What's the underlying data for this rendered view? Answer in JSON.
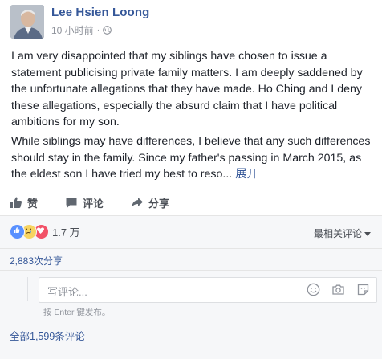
{
  "post": {
    "author": "Lee Hsien Loong",
    "time": "10 小时前",
    "separator": "·",
    "paragraph1": "I am very disappointed that my siblings have chosen to issue a statement publicising private family matters. I am deeply saddened by the unfortunate allegations that they have made. Ho Ching and I deny these allegations, especially the absurd claim that I have political ambitions for my son.",
    "paragraph2": "While siblings may have differences, I believe that any such differences should stay in the family. Since my father's passing in March 2015, as the eldest son I have tried my best to reso...",
    "see_more": "展开"
  },
  "actions": {
    "like": "赞",
    "comment": "评论",
    "share": "分享"
  },
  "reactions": {
    "count": "1.7 万",
    "sort_label": "最相关评论"
  },
  "shares": "2,883次分享",
  "comment_box": {
    "placeholder": "写评论...",
    "hint": "按 Enter 键发布。"
  },
  "all_comments": "全部1,599条评论",
  "colors": {
    "link": "#365899",
    "text": "#1d2129",
    "muted": "#90949c"
  }
}
